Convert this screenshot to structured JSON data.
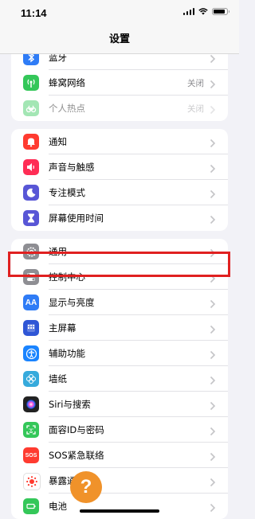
{
  "status_bar": {
    "time": "11:14",
    "battery_level": 0.8
  },
  "nav": {
    "title": "设置"
  },
  "groups": [
    [
      {
        "key": "bluetooth",
        "label": "蓝牙",
        "value": "",
        "icon": "bluetooth-icon",
        "color": "#2f7cf6",
        "partial": true
      },
      {
        "key": "cellular",
        "label": "蜂窝网络",
        "value": "关闭",
        "icon": "antenna-icon",
        "color": "#34c759"
      },
      {
        "key": "hotspot",
        "label": "个人热点",
        "value": "关闭",
        "icon": "hotspot-icon",
        "color": "#34c759",
        "dimmed": true
      }
    ],
    [
      {
        "key": "notifications",
        "label": "通知",
        "icon": "bell-icon",
        "color": "#ff3b30"
      },
      {
        "key": "sounds",
        "label": "声音与触感",
        "icon": "speaker-icon",
        "color": "#ff2d55"
      },
      {
        "key": "focus",
        "label": "专注模式",
        "icon": "moon-icon",
        "color": "#5856d6"
      },
      {
        "key": "screentime",
        "label": "屏幕使用时间",
        "icon": "hourglass-icon",
        "color": "#5856d6"
      }
    ],
    [
      {
        "key": "general",
        "label": "通用",
        "icon": "gear-icon",
        "color": "#8e8e93"
      },
      {
        "key": "control",
        "label": "控制中心",
        "icon": "toggles-icon",
        "color": "#8e8e93"
      },
      {
        "key": "display",
        "label": "显示与亮度",
        "icon": "text-size-icon",
        "color": "#2f7cf6",
        "icon_text": "AA"
      },
      {
        "key": "home",
        "label": "主屏幕",
        "icon": "home-screen-icon",
        "color": "#2f56d6"
      },
      {
        "key": "accessibility",
        "label": "辅助功能",
        "icon": "accessibility-icon",
        "color": "#1a84ff"
      },
      {
        "key": "wallpaper",
        "label": "墙纸",
        "icon": "flower-icon",
        "color": "#36aadc"
      },
      {
        "key": "siri",
        "label": "Siri与搜索",
        "icon": "siri-icon",
        "color": "#222222"
      },
      {
        "key": "faceid",
        "label": "面容ID与密码",
        "icon": "face-id-icon",
        "color": "#34c759"
      },
      {
        "key": "sos",
        "label": "SOS紧急联络",
        "icon": "sos-icon",
        "color": "#ff3b30",
        "icon_text": "SOS"
      },
      {
        "key": "exposure",
        "label": "暴露通知",
        "icon": "exposure-icon",
        "color": "#ffffff"
      },
      {
        "key": "battery",
        "label": "电池",
        "icon": "battery-icon",
        "color": "#34c759",
        "partial": true
      }
    ]
  ],
  "overlays": {
    "help_bubble": "?"
  }
}
